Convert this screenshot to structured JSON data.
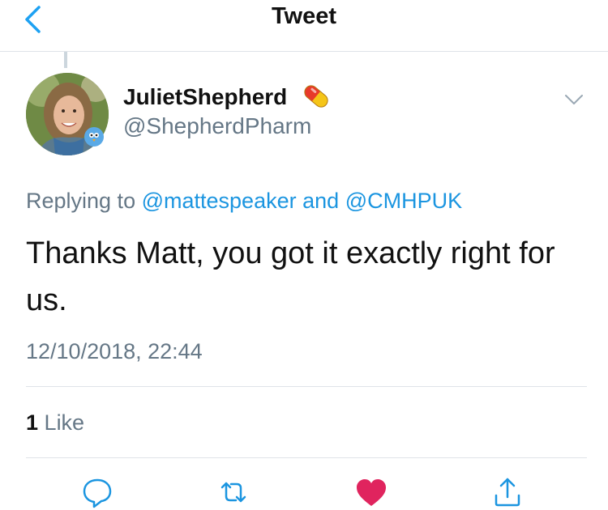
{
  "nav": {
    "title": "Tweet",
    "back_icon": "chevron-left-icon",
    "accent_color": "#1da1f2"
  },
  "tweet": {
    "display_name": "JulietShepherd",
    "name_emoji": "pill-icon",
    "handle": "@ShepherdPharm",
    "replying_prefix": "Replying to",
    "reply_user_1": "@mattespeaker",
    "reply_joiner": "and",
    "reply_user_2": "@CMHPUK",
    "text": "Thanks Matt, you got it exactly right for us.",
    "timestamp": "12/10/2018, 22:44",
    "likes_count": "1",
    "likes_label": "Like",
    "link_color": "#1b95e0",
    "liked_color": "#e0245e"
  },
  "actions": [
    {
      "name": "reply",
      "icon": "reply-icon"
    },
    {
      "name": "retweet",
      "icon": "retweet-icon"
    },
    {
      "name": "like",
      "icon": "heart-icon",
      "active": true
    },
    {
      "name": "share",
      "icon": "share-icon"
    }
  ]
}
